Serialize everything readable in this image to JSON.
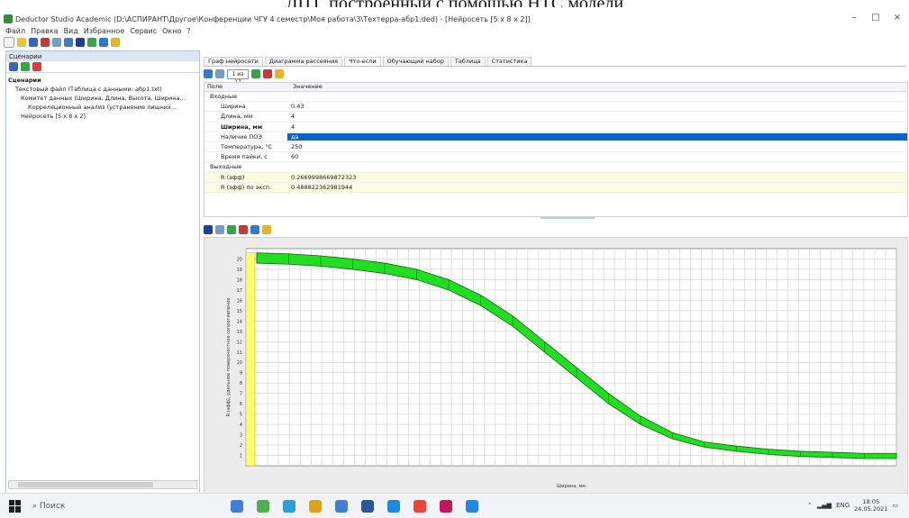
{
  "caption": "ЛЦТ, построенный с помощью НТС модели",
  "window": {
    "title": "Deductor Studio Academic (D:\\АСПИРАНТ\\Другое\\Конференции ЧГУ 4 семестр\\Моя работа\\3\\Техтерра-абр1.ded) - [Нейросеть [5 x 8 x 2]]",
    "min_label": "–",
    "max_label": "□",
    "close_label": "×"
  },
  "menu": [
    "Файл",
    "Правка",
    "Вид",
    "Избранное",
    "Сервис",
    "Окно",
    "?"
  ],
  "left_panel": {
    "title": "Сценарии",
    "tree": [
      "Сценарии",
      "Текстовый файл (Таблица с данными: абр1.txt)",
      "Комитет данных (Ширина, Длина, Высота, Ширина...",
      "Корреляционный анализ (устранение лишних...",
      "Нейросеть [5 x 8 x 2]"
    ]
  },
  "tabs": [
    "Граф нейросети",
    "Диаграмма рассеяния",
    "Что-если",
    "Обучающий набор",
    "Таблица",
    "Статистика"
  ],
  "nav": {
    "counter": "1 из 17"
  },
  "props": {
    "col_field": "Поле",
    "col_value": "Значение",
    "inputs_label": "Входные",
    "rows": [
      {
        "k": "Ширина",
        "v": "0.43"
      },
      {
        "k": "Длина, мм",
        "v": "4"
      },
      {
        "k": "Ширина, мм",
        "v": "4"
      },
      {
        "k": "Наличие ПОЭ",
        "v": "да"
      },
      {
        "k": "Температура, °С",
        "v": "250"
      },
      {
        "k": "Время пайки, с",
        "v": "60"
      }
    ],
    "outputs_label": "Выходные",
    "outputs": [
      {
        "k": "R (эфф)",
        "v": "0.2669998669872323"
      },
      {
        "k": "R (эфф) по эксп.",
        "v": "0.488822362981944"
      }
    ]
  },
  "chart_data": {
    "type": "area",
    "title": "",
    "xlabel": "Ширина, мм",
    "ylabel": "R (эфф), удельное поверхностное сопротивление",
    "ylim": [
      0,
      21
    ],
    "yticks": [
      1,
      2,
      3,
      4,
      5,
      6,
      7,
      8,
      9,
      10,
      11,
      12,
      13,
      14,
      15,
      16,
      17,
      18,
      19,
      20
    ],
    "x": [
      0.0,
      0.05,
      0.1,
      0.15,
      0.2,
      0.25,
      0.3,
      0.35,
      0.4,
      0.45,
      0.5,
      0.55,
      0.6,
      0.65,
      0.7,
      0.75,
      0.8,
      0.85,
      0.9,
      0.95,
      1.0
    ],
    "series": [
      {
        "upper": [
          20.6,
          20.5,
          20.3,
          20.0,
          19.6,
          19.0,
          18.0,
          16.5,
          14.5,
          12.0,
          9.5,
          7.0,
          4.8,
          3.2,
          2.3,
          1.9,
          1.6,
          1.4,
          1.3,
          1.2,
          1.2
        ],
        "lower": [
          19.6,
          19.5,
          19.3,
          19.0,
          18.6,
          18.0,
          17.0,
          15.5,
          13.5,
          11.0,
          8.5,
          6.0,
          4.0,
          2.6,
          1.8,
          1.4,
          1.1,
          0.9,
          0.8,
          0.7,
          0.7
        ]
      }
    ],
    "fill_color": "#22dd22",
    "base_color": "#ffff66"
  },
  "taskbar": {
    "search_placeholder": "Поиск",
    "time": "18:05",
    "date": "24.05.2021",
    "lang": "ENG"
  }
}
